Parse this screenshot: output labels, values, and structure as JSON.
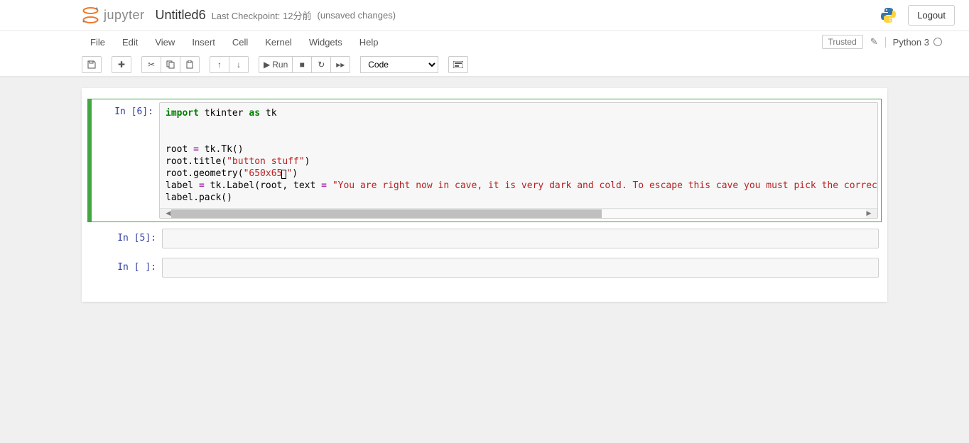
{
  "header": {
    "logo_text": "jupyter",
    "doc_title": "Untitled6",
    "checkpoint": "Last Checkpoint: 12分前",
    "unsaved": "(unsaved changes)",
    "logout_label": "Logout"
  },
  "menubar": {
    "items": [
      "File",
      "Edit",
      "View",
      "Insert",
      "Cell",
      "Kernel",
      "Widgets",
      "Help"
    ],
    "trusted": "Trusted",
    "kernel_name": "Python 3"
  },
  "toolbar": {
    "run_label": "Run",
    "cell_type": "Code"
  },
  "cells": [
    {
      "prompt": "In [6]:",
      "code_lines": [
        {
          "text": "import tkinter as tk"
        },
        {
          "text": ""
        },
        {
          "text": ""
        },
        {
          "text": "root = tk.Tk()"
        },
        {
          "text": "root.title(\"button stuff\")"
        },
        {
          "text": "root.geometry(\"650x65[]\")"
        },
        {
          "text": "label = tk.Label(root, text = \"You are right now in cave, it is very dark and cold. To escape this cave you must pick the correct choices. The"
        },
        {
          "text": "label.pack()"
        }
      ],
      "selected": true,
      "has_scroll": true
    },
    {
      "prompt": "In [5]:",
      "code_lines": [],
      "selected": false,
      "has_scroll": false
    },
    {
      "prompt": "In [ ]:",
      "code_lines": [],
      "selected": false,
      "has_scroll": false
    }
  ]
}
